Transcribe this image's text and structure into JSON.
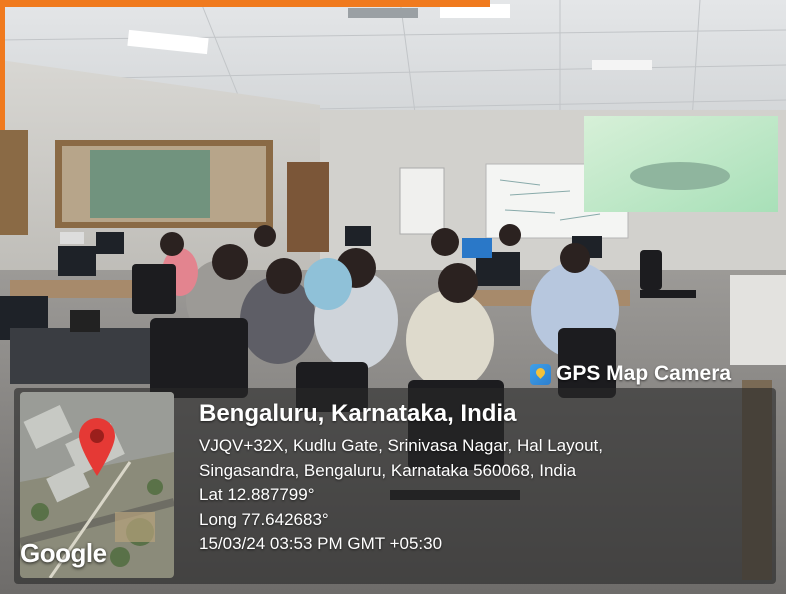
{
  "watermark": {
    "app_name": "GPS Map Camera",
    "app_icon": "gps-map-camera-icon",
    "map_attribution": "Google",
    "map_pin_icon": "map-pin-icon",
    "pin_color": "#e53935"
  },
  "location": {
    "title": "Bengaluru, Karnataka, India",
    "address_line1": "VJQV+32X, Kudlu Gate, Srinivasa Nagar, Hal Layout,",
    "address_line2": "Singasandra, Bengaluru, Karnataka 560068, India",
    "latitude": "Lat 12.887799°",
    "longitude": "Long 77.642683°",
    "timestamp": "15/03/24 03:53 PM GMT +05:30"
  },
  "colors": {
    "frame_accent": "#f07a1e"
  }
}
